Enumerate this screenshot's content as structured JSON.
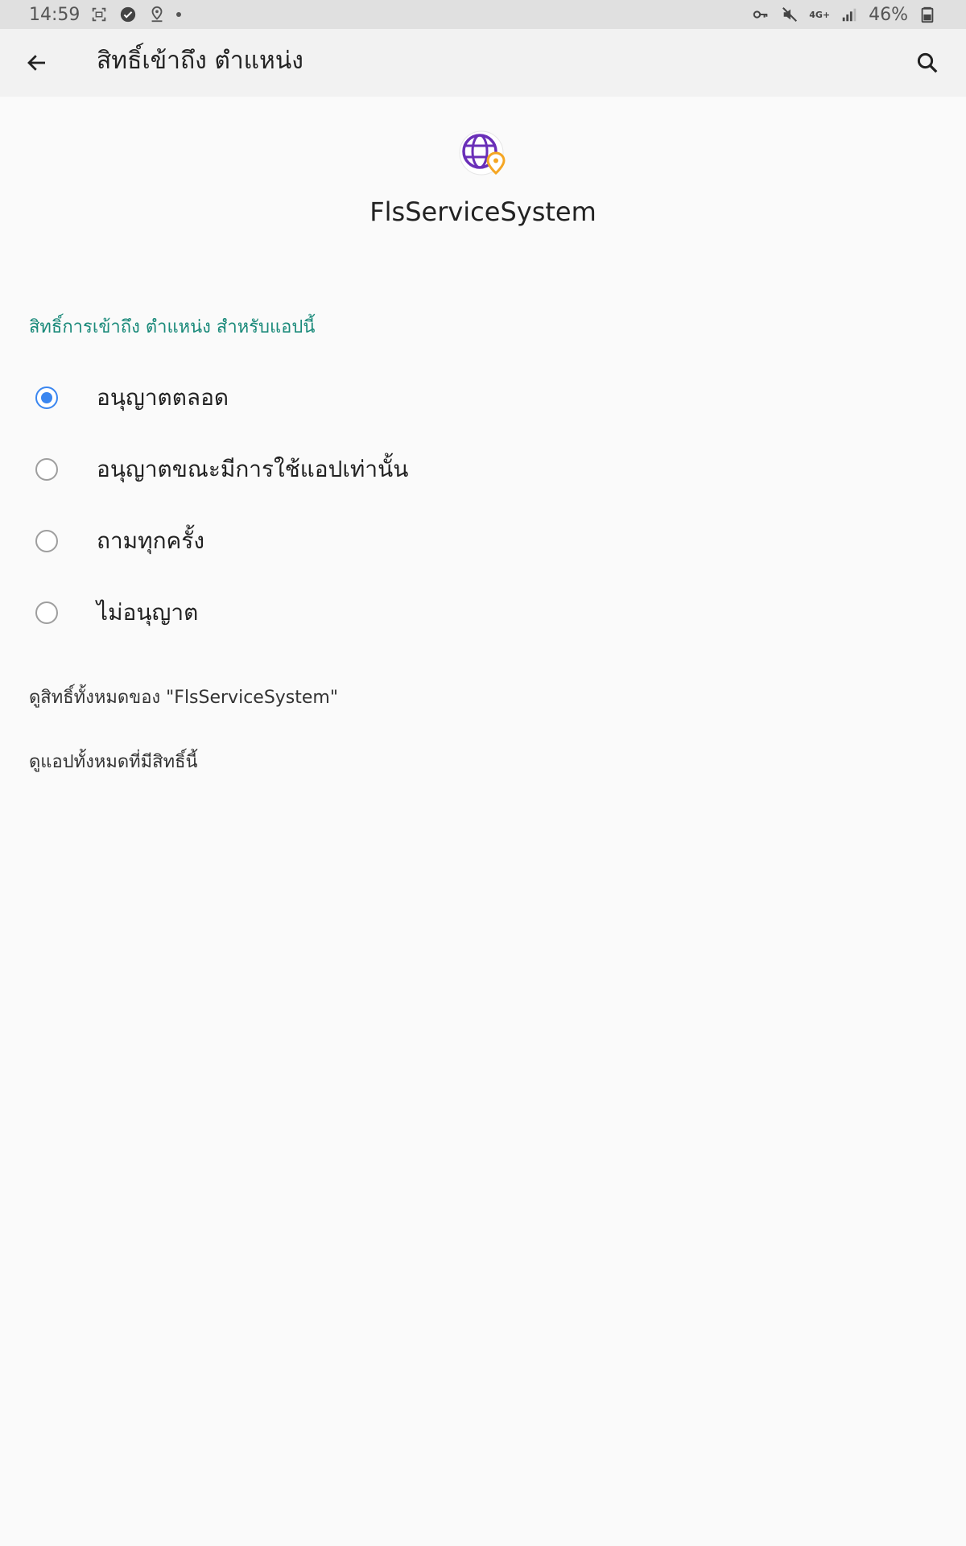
{
  "status_bar": {
    "time": "14:59",
    "battery": "46%",
    "network_label": "4G+",
    "icons_left": [
      "screenshot-icon",
      "check-circle-icon",
      "location-pin-icon",
      "notification-dot"
    ],
    "icons_right": [
      "vpn-key-icon",
      "mute-icon",
      "network-4g-icon",
      "signal-icon",
      "battery-icon"
    ]
  },
  "app_bar": {
    "title": "สิทธิ์เข้าถึง ตำแหน่ง",
    "back_icon": "arrow-left-icon",
    "search_icon": "search-icon"
  },
  "app": {
    "name": "FlsServiceSystem",
    "icon": "globe-location-icon"
  },
  "section": {
    "label": "สิทธิ์การเข้าถึง ตำแหน่ง สำหรับแอปนี้"
  },
  "options": [
    {
      "label": "อนุญาตตลอด",
      "checked": true
    },
    {
      "label": "อนุญาตขณะมีการใช้แอปเท่านั้น",
      "checked": false
    },
    {
      "label": "ถามทุกครั้ง",
      "checked": false
    },
    {
      "label": "ไม่อนุญาต",
      "checked": false
    }
  ],
  "links": {
    "view_all_permissions": "ดูสิทธิ์ทั้งหมดของ \"FlsServiceSystem\"",
    "view_all_apps": "ดูแอปทั้งหมดที่มีสิทธิ์นี้"
  },
  "colors": {
    "accent": "#3a86f0",
    "section_label": "#1a8a7a",
    "globe_purple": "#6a2fb8",
    "pin_orange": "#f5a623",
    "status_bar_bg": "#e0e0e0",
    "app_bar_bg": "#f2f2f2",
    "page_bg": "#fafafa"
  }
}
